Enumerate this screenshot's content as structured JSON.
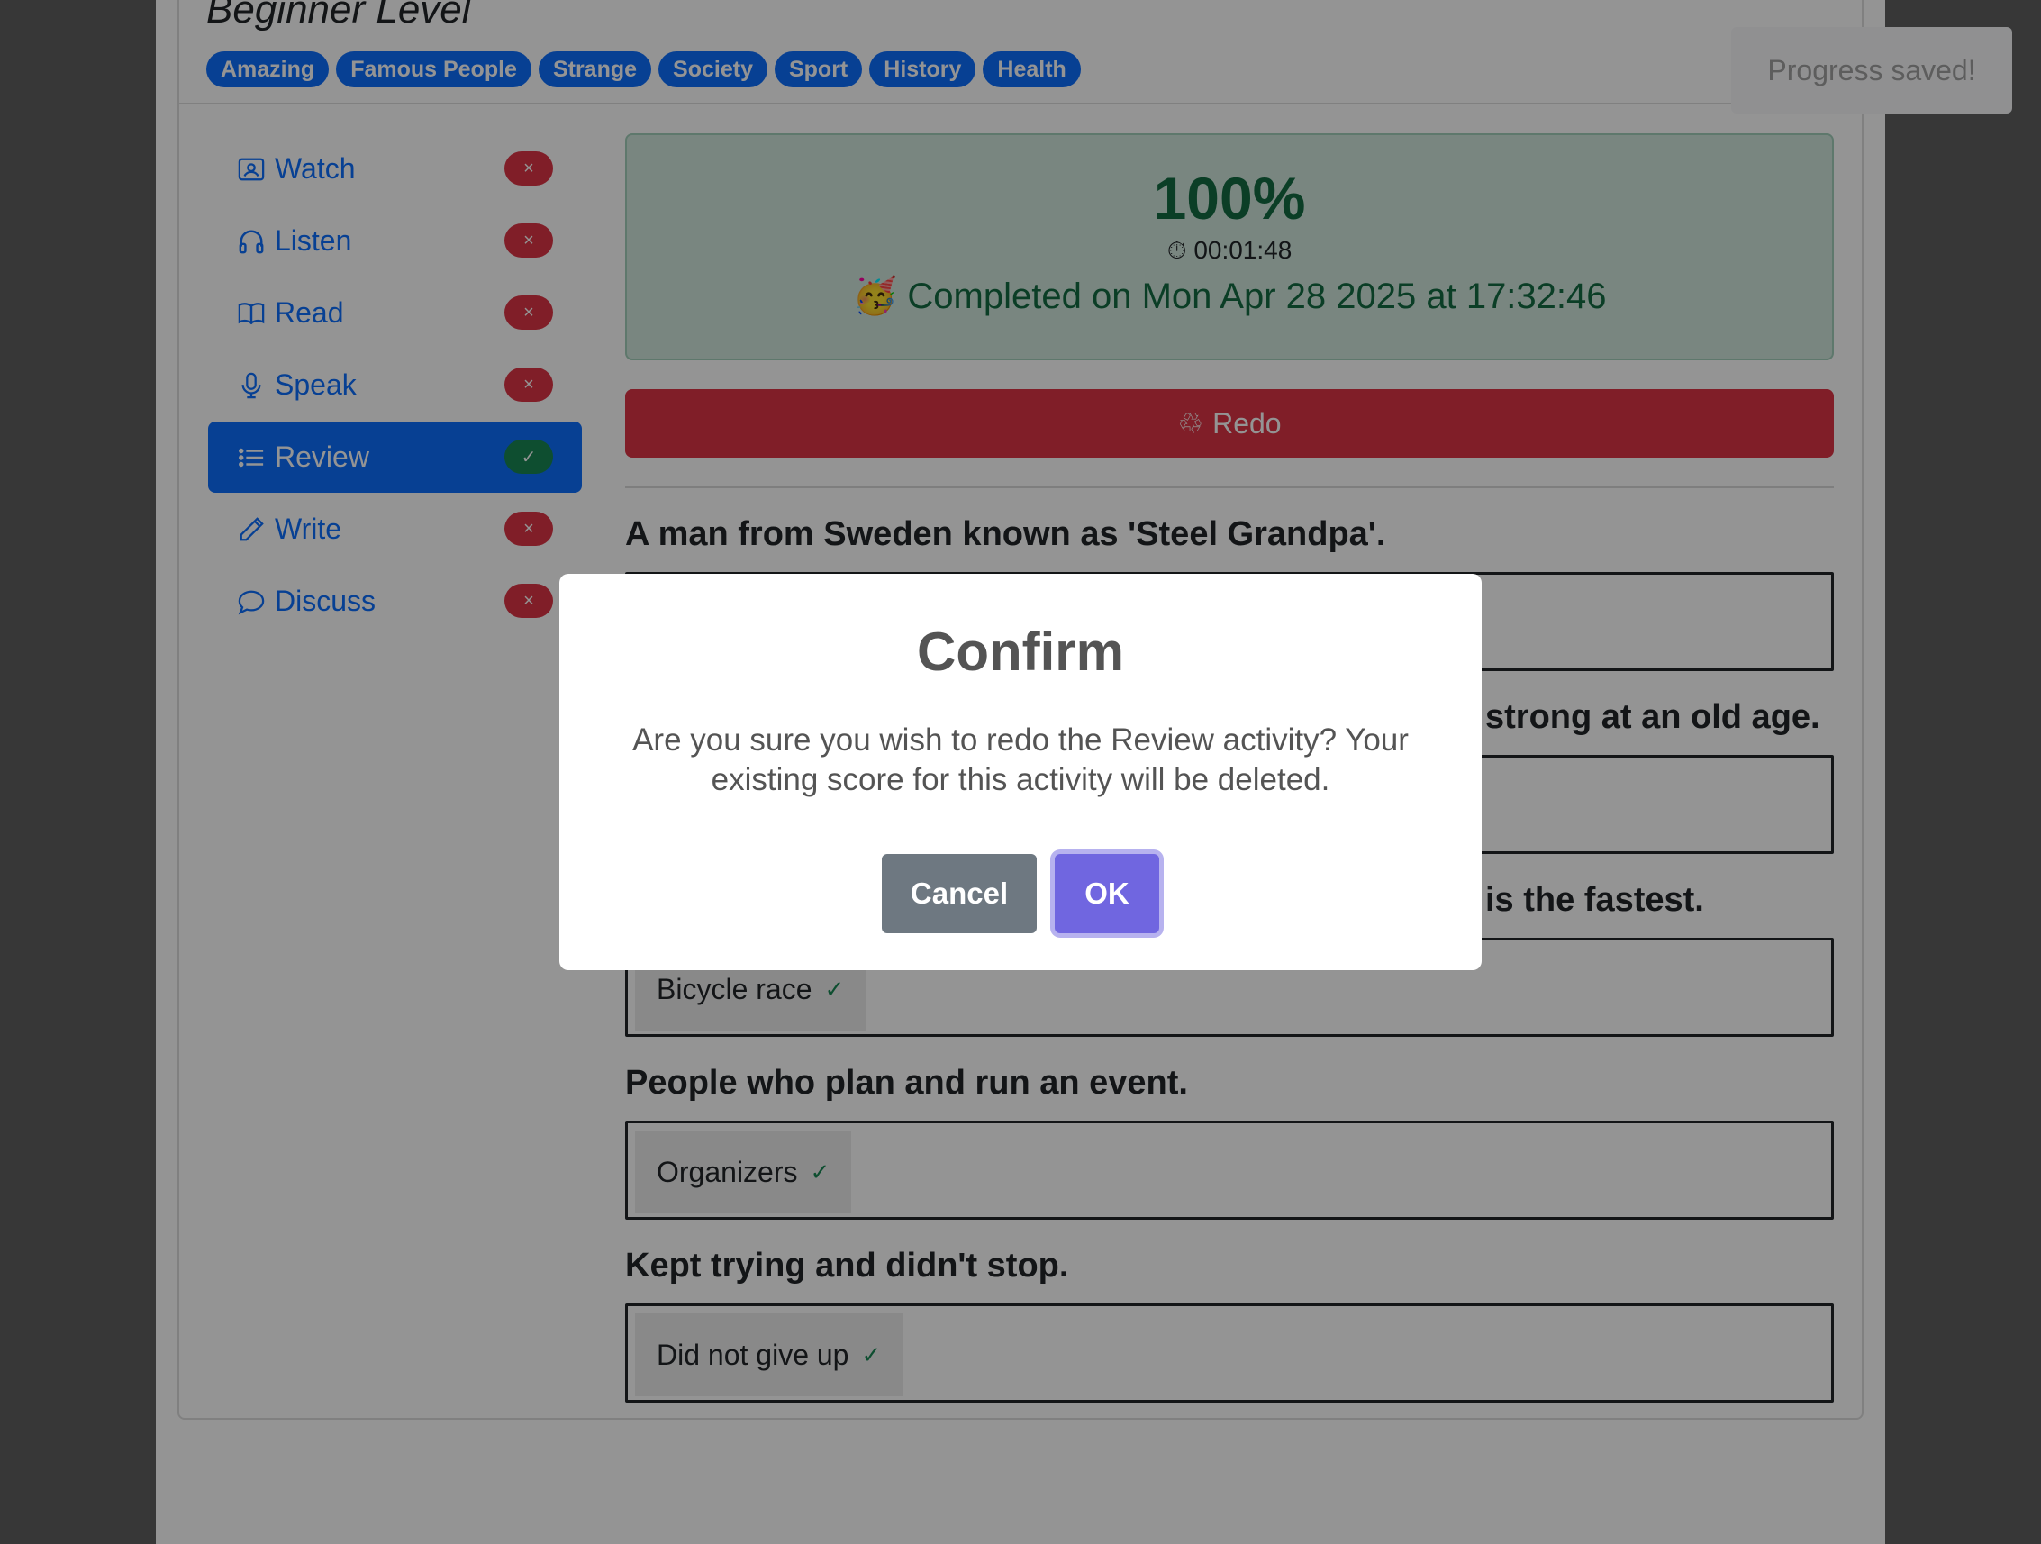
{
  "header": {
    "level_title": "Beginner Level",
    "tags": [
      "Amazing",
      "Famous People",
      "Strange",
      "Society",
      "Sport",
      "History",
      "Health"
    ]
  },
  "toast": {
    "text": "Progress saved!"
  },
  "nav": {
    "items": [
      {
        "label": "Watch",
        "icon": "person-video-icon",
        "status": "×"
      },
      {
        "label": "Listen",
        "icon": "headphones-icon",
        "status": "×"
      },
      {
        "label": "Read",
        "icon": "book-icon",
        "status": "×"
      },
      {
        "label": "Speak",
        "icon": "mic-icon",
        "status": "×"
      },
      {
        "label": "Review",
        "icon": "list-icon",
        "status": "✓",
        "active": true
      },
      {
        "label": "Write",
        "icon": "pencil-icon",
        "status": "×"
      },
      {
        "label": "Discuss",
        "icon": "chat-icon",
        "status": "×"
      }
    ]
  },
  "result": {
    "percent": "100%",
    "timer_icon": "stopwatch-icon",
    "time": "00:01:48",
    "emoji": "🥳",
    "completed": "Completed on Mon Apr 28 2025 at 17:32:46"
  },
  "redo": {
    "label": "Redo",
    "icon": "recycle-icon"
  },
  "questions": [
    {
      "prompt": "A man from Sweden known as 'Steel Grandpa'.",
      "answer": ""
    },
    {
      "prompt": "strong at an old age.",
      "answer": ""
    },
    {
      "prompt": "is the fastest.",
      "answer": "Bicycle race"
    },
    {
      "prompt": "People who plan and run an event.",
      "answer": "Organizers"
    },
    {
      "prompt": "Kept trying and didn't stop.",
      "answer": "Did not give up"
    }
  ],
  "check_mark": "✓",
  "modal": {
    "title": "Confirm",
    "text": "Are you sure you wish to redo the Review activity? Your existing score for this activity will be deleted.",
    "cancel_label": "Cancel",
    "ok_label": "OK"
  },
  "colors": {
    "primary": "#0d6efd",
    "danger": "#dc3545",
    "success": "#198754",
    "modal_ok": "#7066e0",
    "modal_cancel": "#6e7881"
  }
}
